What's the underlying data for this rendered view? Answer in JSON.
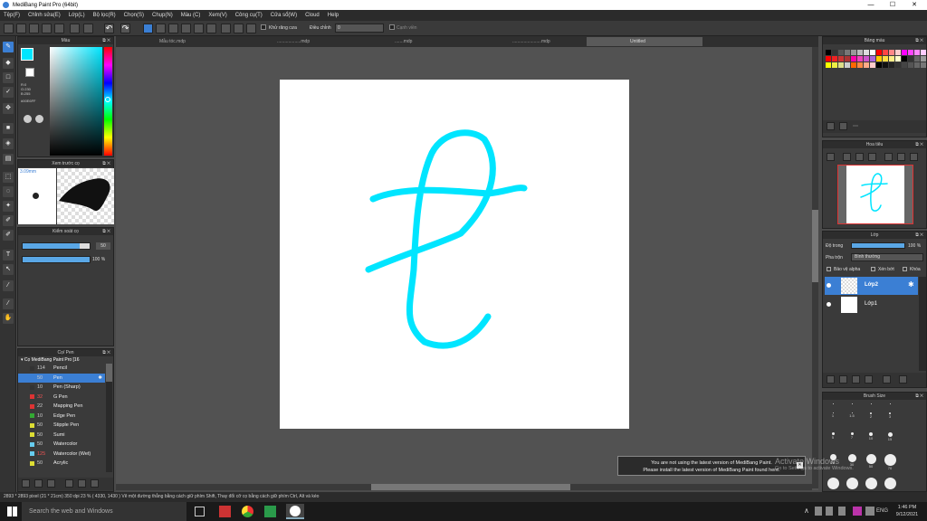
{
  "window": {
    "title": "MediBang Paint Pro (64bit)",
    "min": "—",
    "max": "☐",
    "close": "✕"
  },
  "menu": [
    "Tệp(F)",
    "Chỉnh sửa(E)",
    "Lớp(L)",
    "Bộ lọc(R)",
    "Chọn(S)",
    "Chụp(N)",
    "Màu (C)",
    "Xem(V)",
    "Công cụ(T)",
    "Cửa sổ(W)",
    "Cloud",
    "Help"
  ],
  "toolbar": {
    "antialias_label": "Khử răng cưa",
    "adjust_label": "Điều chỉnh",
    "adjust_value": "0",
    "edge_label": "Cạnh viền"
  },
  "tabs": [
    "Mẫu tóc.mdp",
    "...................mdp",
    ".......mdp",
    ".......................mdp",
    "Untitled"
  ],
  "color_panel": {
    "title": "Màu",
    "r": "R:0",
    "g": "G:230",
    "b": "B:255",
    "hex": "#00E6FF"
  },
  "brush_preview": {
    "title": "Xem trước cọ",
    "size": "3.09mm"
  },
  "brush_control": {
    "title": "Kiểm soát cọ",
    "size_value": "50",
    "opacity_value": "100 %",
    "size_fraction": 0.85,
    "opacity_fraction": 1.0
  },
  "brush_panel": {
    "title": "Cọ/ Pen",
    "group": "Cọ MediBang Paint Pro [16",
    "items": [
      {
        "size": "114",
        "name": "Pencil",
        "color": "#333333"
      },
      {
        "size": "50",
        "name": "Pen",
        "color": "#3b7fd4"
      },
      {
        "size": "10",
        "name": "Pen (Sharp)",
        "color": "#333333"
      },
      {
        "size": "32",
        "name": "G Pen",
        "color": "#dd3333"
      },
      {
        "size": "22",
        "name": "Mapping Pen",
        "color": "#dd3333"
      },
      {
        "size": "10",
        "name": "Edge Pen",
        "color": "#33aa33"
      },
      {
        "size": "50",
        "name": "Stipple Pen",
        "color": "#dddd33"
      },
      {
        "size": "50",
        "name": "Sumi",
        "color": "#dddd33"
      },
      {
        "size": "50",
        "name": "Watercolor",
        "color": "#66ccee"
      },
      {
        "size": "125",
        "name": "Watercolor (Wet)",
        "color": "#66ccee"
      },
      {
        "size": "50",
        "name": "Acrylic",
        "color": "#dddd33"
      }
    ]
  },
  "palette_panel": {
    "title": "Bảng màu"
  },
  "navigator_panel": {
    "title": "Hoa tiêu"
  },
  "layer_panel": {
    "title": "Lớp",
    "opacity_label": "Độ trong",
    "opacity_value": "100 %",
    "blend_label": "Pha trộn",
    "blend_value": "Bình thường",
    "protect_alpha": "Bảo vệ alpha",
    "clipping": "Xén bớt",
    "lock": "Khóa",
    "layers": [
      {
        "name": "Lớp2",
        "selected": true
      },
      {
        "name": "Lớp1",
        "selected": false
      }
    ]
  },
  "brush_size_panel": {
    "title": "Brush Size",
    "sizes": [
      "1",
      "1.5",
      "2",
      "3",
      "5",
      "7",
      "10",
      "15",
      "20",
      "30",
      "50",
      "70"
    ]
  },
  "status": "2893 * 2893 pixel  (21 * 21cm)  350 dpi  23 %  ( 4330, 1430 )  Vẽ một đường thẳng bằng cách giữ phím Shift, Thay đổi cỡ cọ bằng cách giữ phím Ctrl, Alt và kéo",
  "notification": {
    "line1": "You are not using the latest version of MediBang Paint.",
    "line2": "Please install the latest version of MediBang Paint found here."
  },
  "watermark": {
    "line1": "Activate Windows",
    "line2": "Go to Settings to activate Windows."
  },
  "taskbar": {
    "search": "Search the web and Windows",
    "lang": "ENG",
    "time": "1:46 PM",
    "date": "9/12/2021"
  },
  "stroke_color": "#00E5FF"
}
